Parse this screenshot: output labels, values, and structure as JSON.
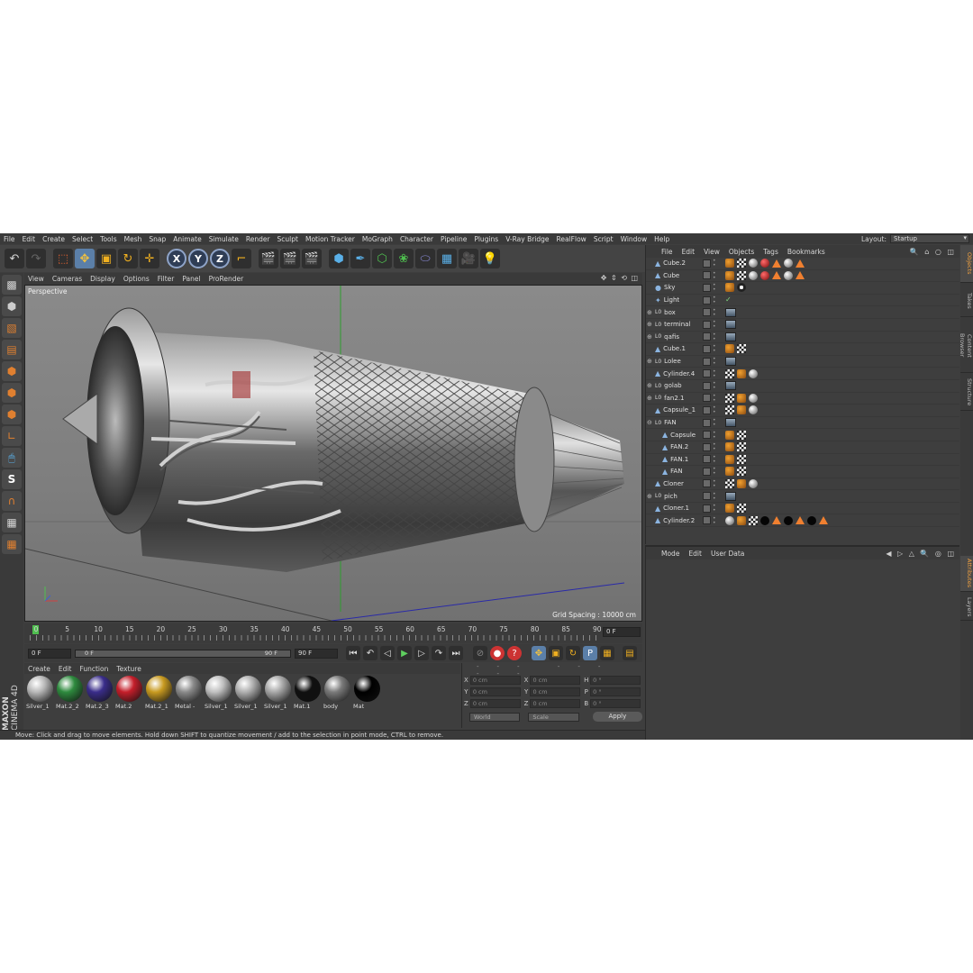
{
  "menubar": {
    "items": [
      "File",
      "Edit",
      "Create",
      "Select",
      "Tools",
      "Mesh",
      "Snap",
      "Animate",
      "Simulate",
      "Render",
      "Sculpt",
      "Motion Tracker",
      "MoGraph",
      "Character",
      "Pipeline",
      "Plugins",
      "V-Ray Bridge",
      "RealFlow",
      "Script",
      "Window",
      "Help"
    ],
    "layout_label": "Layout:",
    "layout_value": "Startup"
  },
  "toolbar": {
    "axis_x": "X",
    "axis_y": "Y",
    "axis_z": "Z"
  },
  "viewport": {
    "menu": [
      "View",
      "Cameras",
      "Display",
      "Options",
      "Filter",
      "Panel",
      "ProRender"
    ],
    "camera_label": "Perspective",
    "grid_spacing": "Grid Spacing : 10000 cm"
  },
  "timeline": {
    "ticks": [
      "0",
      "5",
      "10",
      "15",
      "20",
      "25",
      "30",
      "35",
      "40",
      "45",
      "50",
      "55",
      "60",
      "65",
      "70",
      "75",
      "80",
      "85",
      "90"
    ],
    "end_frame": "0 F"
  },
  "transport": {
    "current_frame": "0 F",
    "range_start": "0 F",
    "range_end": "90 F",
    "max_frame": "90 F"
  },
  "materials": {
    "menu": [
      "Create",
      "Edit",
      "Function",
      "Texture"
    ],
    "items": [
      {
        "name": "Silver_1",
        "color": "#b8b8b8"
      },
      {
        "name": "Mat.2_2",
        "color": "#2e8a3e"
      },
      {
        "name": "Mat.2_3",
        "color": "#3a2d8a"
      },
      {
        "name": "Mat.2",
        "color": "#c41e2a"
      },
      {
        "name": "Mat.2_1",
        "color": "#c89a20"
      },
      {
        "name": "Metal - ",
        "color": "#8a8a8a"
      },
      {
        "name": "Silver_1",
        "color": "#c0c0c0"
      },
      {
        "name": "Silver_1",
        "color": "#b0b0b0"
      },
      {
        "name": "Silver_1",
        "color": "#a8a8a8"
      },
      {
        "name": "Mat.1",
        "color": "#101010"
      },
      {
        "name": "body",
        "color": "#7a7a7a"
      },
      {
        "name": "Mat",
        "color": "#000000"
      }
    ]
  },
  "coordinates": {
    "header": "--- --- ---",
    "rows": [
      {
        "axis": "X",
        "pos": "0 cm",
        "size_axis": "X",
        "size": "0 cm",
        "rot_axis": "H",
        "rot": "0 °"
      },
      {
        "axis": "Y",
        "pos": "0 cm",
        "size_axis": "Y",
        "size": "0 cm",
        "rot_axis": "P",
        "rot": "0 °"
      },
      {
        "axis": "Z",
        "pos": "0 cm",
        "size_axis": "Z",
        "size": "0 cm",
        "rot_axis": "B",
        "rot": "0 °"
      }
    ],
    "mode": "World",
    "size_mode": "Scale",
    "apply": "Apply"
  },
  "status": {
    "text": "Move: Click and drag to move elements. Hold down SHIFT to quantize movement / add to the selection in point mode, CTRL to remove."
  },
  "branding": {
    "line1": "MAXON",
    "line2": "CINEMA 4D"
  },
  "object_manager": {
    "menu": [
      "File",
      "Edit",
      "View",
      "Objects",
      "Tags",
      "Bookmarks"
    ],
    "objects": [
      {
        "name": "Cube.2",
        "icon": "cube-icon",
        "indent": 0,
        "expander": "",
        "tags": [
          "o",
          "c",
          "s",
          "r",
          "t",
          "s",
          "t"
        ]
      },
      {
        "name": "Cube",
        "icon": "cube-icon",
        "indent": 0,
        "expander": "",
        "tags": [
          "o",
          "c",
          "s",
          "r",
          "t",
          "s",
          "t"
        ]
      },
      {
        "name": "Sky",
        "icon": "sky-icon",
        "indent": 0,
        "expander": "",
        "tags": [
          "o",
          "sky"
        ]
      },
      {
        "name": "Light",
        "icon": "light-icon",
        "indent": 0,
        "expander": "",
        "tags": [
          "chk"
        ]
      },
      {
        "name": "box",
        "icon": "null-icon",
        "indent": 0,
        "expander": "+",
        "tags": [
          "ph"
        ]
      },
      {
        "name": "terminal",
        "icon": "null-icon",
        "indent": 0,
        "expander": "+",
        "tags": [
          "ph"
        ]
      },
      {
        "name": "qafis",
        "icon": "null-icon",
        "indent": 0,
        "expander": "+",
        "tags": [
          "ph"
        ]
      },
      {
        "name": "Cube.1",
        "icon": "cube-icon",
        "indent": 0,
        "expander": "",
        "tags": [
          "o",
          "c"
        ]
      },
      {
        "name": "Lolee",
        "icon": "null-icon",
        "indent": 0,
        "expander": "+",
        "tags": [
          "ph"
        ]
      },
      {
        "name": "Cylinder.4",
        "icon": "cylinder-icon",
        "indent": 0,
        "expander": "",
        "tags": [
          "c",
          "o",
          "s"
        ]
      },
      {
        "name": "golab",
        "icon": "null-icon",
        "indent": 0,
        "expander": "+",
        "tags": [
          "ph"
        ]
      },
      {
        "name": "fan2.1",
        "icon": "null-icon",
        "indent": 0,
        "expander": "+",
        "tags": [
          "c",
          "o",
          "s"
        ]
      },
      {
        "name": "Capsule_1",
        "icon": "capsule-icon",
        "indent": 0,
        "expander": "",
        "tags": [
          "c",
          "o",
          "s"
        ]
      },
      {
        "name": "FAN",
        "icon": "null-icon",
        "indent": 0,
        "expander": "-",
        "tags": [
          "ph"
        ]
      },
      {
        "name": "Capsule",
        "icon": "capsule-icon",
        "indent": 1,
        "expander": "",
        "tags": [
          "o",
          "c"
        ]
      },
      {
        "name": "FAN.2",
        "icon": "fan-icon",
        "indent": 1,
        "expander": "",
        "tags": [
          "o",
          "c"
        ]
      },
      {
        "name": "FAN.1",
        "icon": "fan-icon",
        "indent": 1,
        "expander": "",
        "tags": [
          "o",
          "c"
        ]
      },
      {
        "name": "FAN",
        "icon": "fan-icon",
        "indent": 1,
        "expander": "",
        "tags": [
          "o",
          "c"
        ]
      },
      {
        "name": "Cloner",
        "icon": "cloner-icon",
        "indent": 0,
        "expander": "",
        "tags": [
          "c",
          "o",
          "s"
        ]
      },
      {
        "name": "pich",
        "icon": "null-icon",
        "indent": 0,
        "expander": "+",
        "tags": [
          "ph"
        ]
      },
      {
        "name": "Cloner.1",
        "icon": "cloner-icon",
        "indent": 0,
        "expander": "",
        "tags": [
          "o",
          "c"
        ]
      },
      {
        "name": "Cylinder.2",
        "icon": "cylinder-icon",
        "indent": 0,
        "expander": "",
        "tags": [
          "s",
          "o",
          "c",
          "k",
          "t",
          "k",
          "t",
          "k",
          "t"
        ]
      }
    ]
  },
  "attribute_manager": {
    "menu": [
      "Mode",
      "Edit",
      "User Data"
    ]
  },
  "right_tabs": [
    "Objects",
    "Takes",
    "Content Browser",
    "Structure",
    "Attributes",
    "Layers"
  ]
}
